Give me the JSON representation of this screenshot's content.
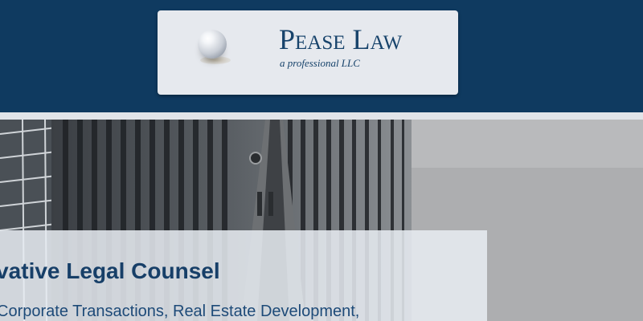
{
  "brand": {
    "name": "Pease Law",
    "tagline": "a professional LLC"
  },
  "hero": {
    "headline": "ovative Legal Counsel",
    "subline": "Corporate Transactions, Real Estate Development,"
  },
  "colors": {
    "header_bg": "#0f3a60",
    "card_bg": "#e6e9ee",
    "brand_text": "#17436b",
    "headline_text": "#173f68",
    "overlay_bg": "#e8ecf2"
  },
  "icons": {
    "logo": "pearl-icon"
  }
}
